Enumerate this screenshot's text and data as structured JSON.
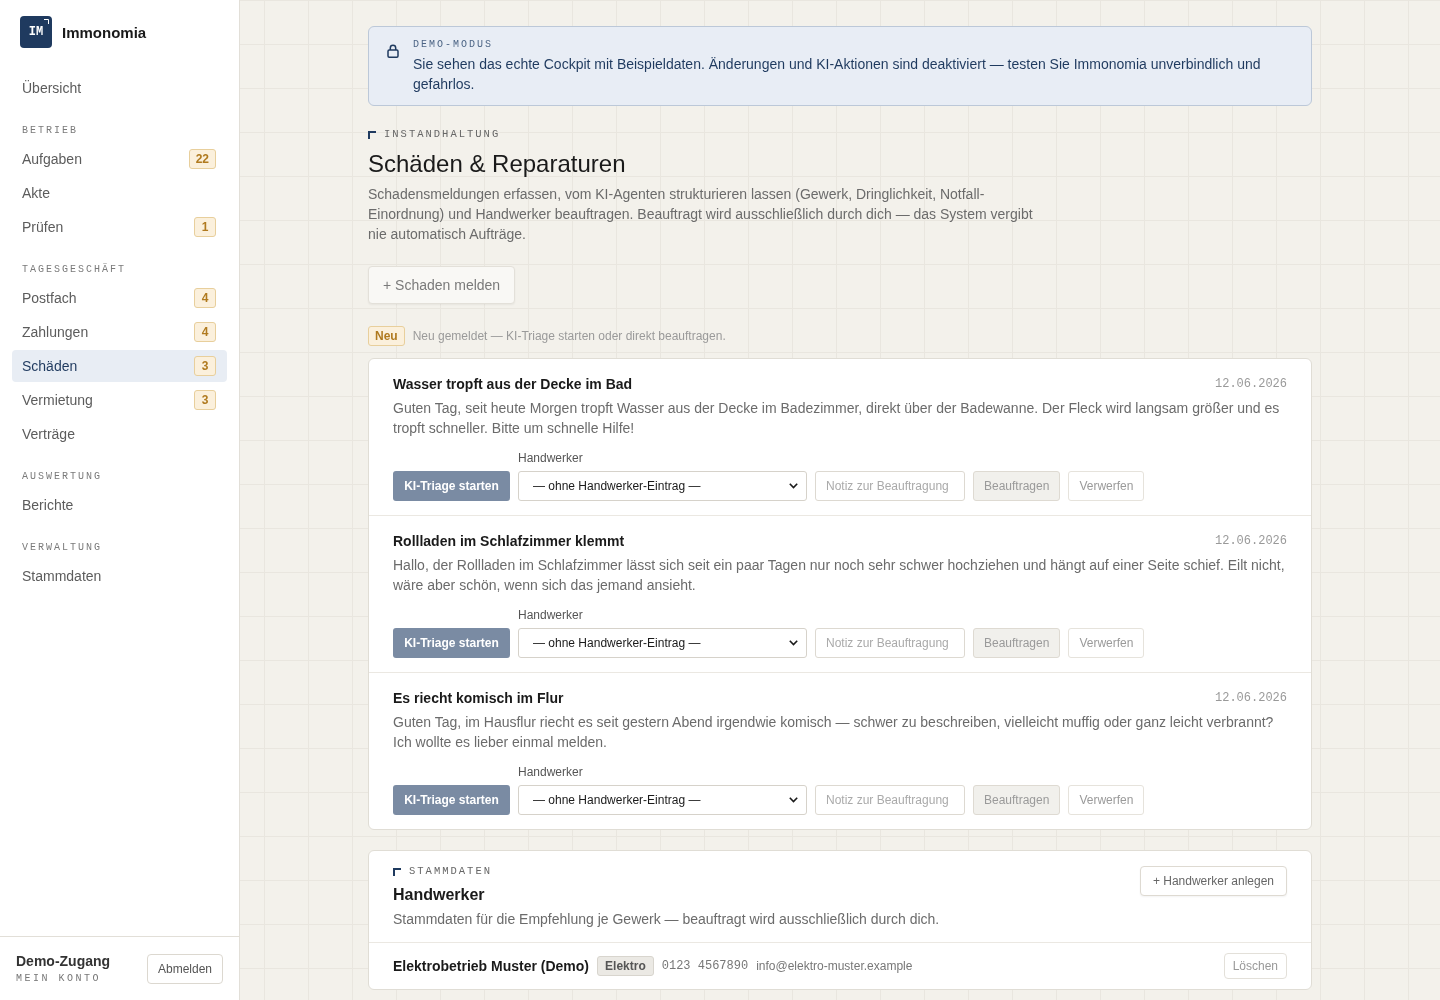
{
  "sidebar": {
    "brand": {
      "logo": "IM",
      "name": "Immonomia"
    },
    "top_items": [
      {
        "label": "Übersicht",
        "selected": false
      }
    ],
    "groups": [
      {
        "title": "BETRIEB",
        "items": [
          {
            "label": "Aufgaben",
            "badge": "22",
            "selected": false
          },
          {
            "label": "Akte",
            "selected": false
          },
          {
            "label": "Prüfen",
            "badge": "1",
            "selected": false
          }
        ]
      },
      {
        "title": "TAGESGESCHÄFT",
        "items": [
          {
            "label": "Postfach",
            "badge": "4",
            "selected": false
          },
          {
            "label": "Zahlungen",
            "badge": "4",
            "selected": false
          },
          {
            "label": "Schäden",
            "badge": "3",
            "selected": true
          },
          {
            "label": "Vermietung",
            "badge": "3",
            "selected": false
          },
          {
            "label": "Verträge",
            "selected": false
          }
        ]
      },
      {
        "title": "AUSWERTUNG",
        "items": [
          {
            "label": "Berichte",
            "selected": false
          }
        ]
      },
      {
        "title": "VERWALTUNG",
        "items": [
          {
            "label": "Stammdaten",
            "selected": false
          }
        ]
      }
    ],
    "account": {
      "name": "Demo-Zugang",
      "caption": "MEIN KONTO",
      "logout_button": "Abmelden"
    }
  },
  "demo_banner": {
    "title": "DEMO-MODUS",
    "text": "Sie sehen das echte Cockpit mit Beispieldaten. Änderungen und KI-Aktionen sind deaktiviert — testen Sie Immonomia unverbindlich und gefahrlos."
  },
  "header": {
    "eyebrow": "INSTANDHALTUNG",
    "title": "Schäden & Reparaturen",
    "description": "Schadensmeldungen erfassen, vom KI-Agenten strukturieren lassen (Gewerk, Dringlichkeit, Notfall-Einordnung) und Handwerker beauftragen. Beauftragt wird ausschließlich durch dich — das System vergibt nie automatisch Aufträge.",
    "report_button": "+ Schaden melden"
  },
  "new_reports": {
    "badge": "Neu",
    "hint": "Neu gemeldet — KI-Triage starten oder direkt beauftragen.",
    "items": [
      {
        "title": "Wasser tropft aus der Decke im Bad",
        "date": "12.06.2026",
        "text": "Guten Tag, seit heute Morgen tropft Wasser aus der Decke im Badezimmer, direkt über der Badewanne. Der Fleck wird langsam größer und es tropft schneller. Bitte um schnelle Hilfe!",
        "triage_button": "KI-Triage starten",
        "craftsman_label": "Handwerker",
        "craftsman_select": "— ohne Handwerker-Eintrag —",
        "note_placeholder": "Notiz zur Beauftragung",
        "assign_button": {
          "label": "Beauftragen",
          "disabled": true
        },
        "discard_button": "Verwerfen"
      },
      {
        "title": "Rollladen im Schlafzimmer klemmt",
        "date": "12.06.2026",
        "text": "Hallo, der Rollladen im Schlafzimmer lässt sich seit ein paar Tagen nur noch sehr schwer hochziehen und hängt auf einer Seite schief. Eilt nicht, wäre aber schön, wenn sich das jemand ansieht.",
        "triage_button": "KI-Triage starten",
        "craftsman_label": "Handwerker",
        "craftsman_select": "— ohne Handwerker-Eintrag —",
        "note_placeholder": "Notiz zur Beauftragung",
        "assign_button": {
          "label": "Beauftragen",
          "disabled": true
        },
        "discard_button": "Verwerfen"
      },
      {
        "title": "Es riecht komisch im Flur",
        "date": "12.06.2026",
        "text": "Guten Tag, im Hausflur riecht es seit gestern Abend irgendwie komisch — schwer zu beschreiben, vielleicht muffig oder ganz leicht verbrannt? Ich wollte es lieber einmal melden.",
        "triage_button": "KI-Triage starten",
        "craftsman_label": "Handwerker",
        "craftsman_select": "— ohne Handwerker-Eintrag —",
        "note_placeholder": "Notiz zur Beauftragung",
        "assign_button": {
          "label": "Beauftragen",
          "disabled": true
        },
        "discard_button": "Verwerfen"
      }
    ]
  },
  "craftsmen": {
    "eyebrow": "STAMMDATEN",
    "title": "Handwerker",
    "description": "Stammdaten für die Empfehlung je Gewerk — beauftragt wird ausschließlich durch dich.",
    "add_button": "+ Handwerker anlegen",
    "rows": [
      {
        "name": "Elektrobetrieb Muster (Demo)",
        "trade": "Elektro",
        "phone": "0123 4567890",
        "email": "info@elektro-muster.example",
        "delete_button": "Löschen"
      }
    ]
  }
}
